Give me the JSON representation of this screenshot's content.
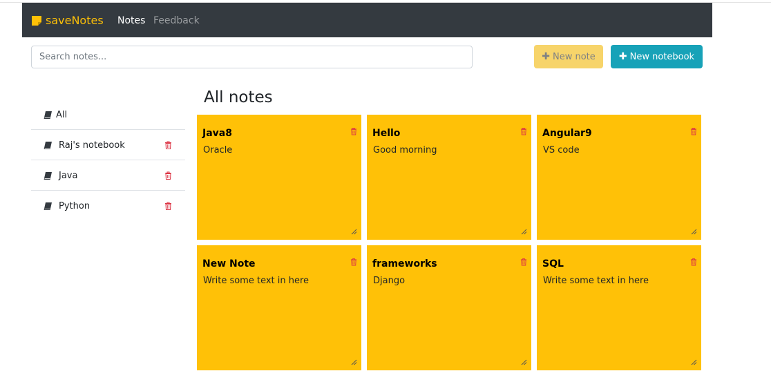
{
  "navbar": {
    "brand": "saveNotes",
    "links": [
      "Notes",
      "Feedback"
    ]
  },
  "search": {
    "placeholder": "Search notes..."
  },
  "actions": {
    "new_note": "New note",
    "new_notebook": "New notebook"
  },
  "sidebar": {
    "items": [
      {
        "label": "All"
      },
      {
        "label": "Raj's notebook"
      },
      {
        "label": "Java"
      },
      {
        "label": "Python"
      }
    ]
  },
  "main": {
    "title": "All notes",
    "notes": [
      {
        "title": "Java8",
        "body": "Oracle"
      },
      {
        "title": "Hello",
        "body": "Good morning"
      },
      {
        "title": "Angular9",
        "body": "VS code"
      },
      {
        "title": "New Note",
        "body": "Write some text in here"
      },
      {
        "title": "frameworks",
        "body": "Django"
      },
      {
        "title": "SQL",
        "body": "Write some text in here"
      }
    ]
  },
  "colors": {
    "navbar": "#343a40",
    "brand": "#ffc107",
    "note": "#ffc107",
    "new_note_button": "#f7d46a",
    "new_notebook_button": "#17a2b8",
    "delete_icon": "#dc3545"
  },
  "icons": {
    "brand": "note-icon",
    "notebook": "book-icon",
    "delete": "trash-icon",
    "add": "plus-icon",
    "resize": "resize-grip-icon"
  }
}
